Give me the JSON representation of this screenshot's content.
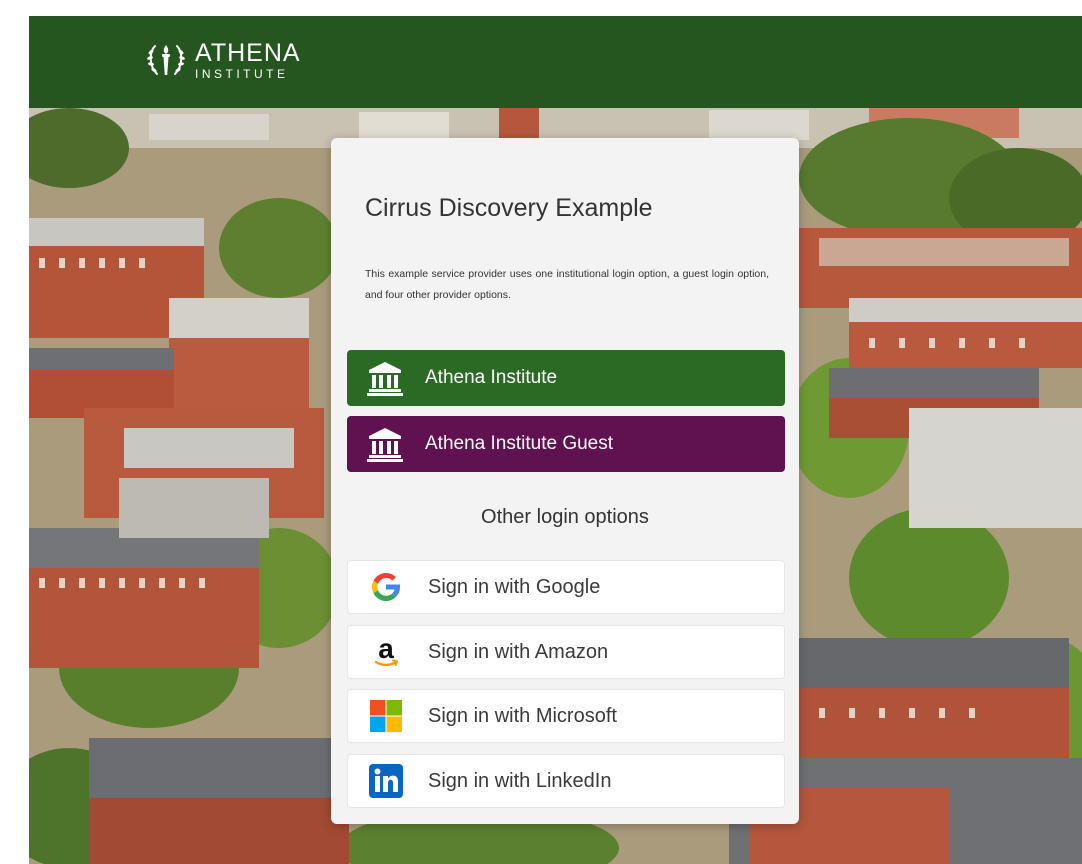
{
  "header": {
    "logo_title": "ATHENA",
    "logo_subtitle": "INSTITUTE"
  },
  "card": {
    "title": "Cirrus Discovery Example",
    "description": "This example service provider uses one institutional login option, a guest login option, and four other provider options.",
    "institution_button": "Athena Institute",
    "guest_button": "Athena Institute Guest",
    "other_options_label": "Other login options",
    "providers": [
      {
        "label": "Sign in with Google",
        "icon": "google-icon"
      },
      {
        "label": "Sign in with Amazon",
        "icon": "amazon-icon"
      },
      {
        "label": "Sign in with Microsoft",
        "icon": "microsoft-icon"
      },
      {
        "label": "Sign in with LinkedIn",
        "icon": "linkedin-icon"
      }
    ]
  },
  "colors": {
    "header_green": "#26561f",
    "institution_green": "#2b6a25",
    "guest_purple": "#60114f",
    "linkedin_blue": "#0a66c2"
  }
}
